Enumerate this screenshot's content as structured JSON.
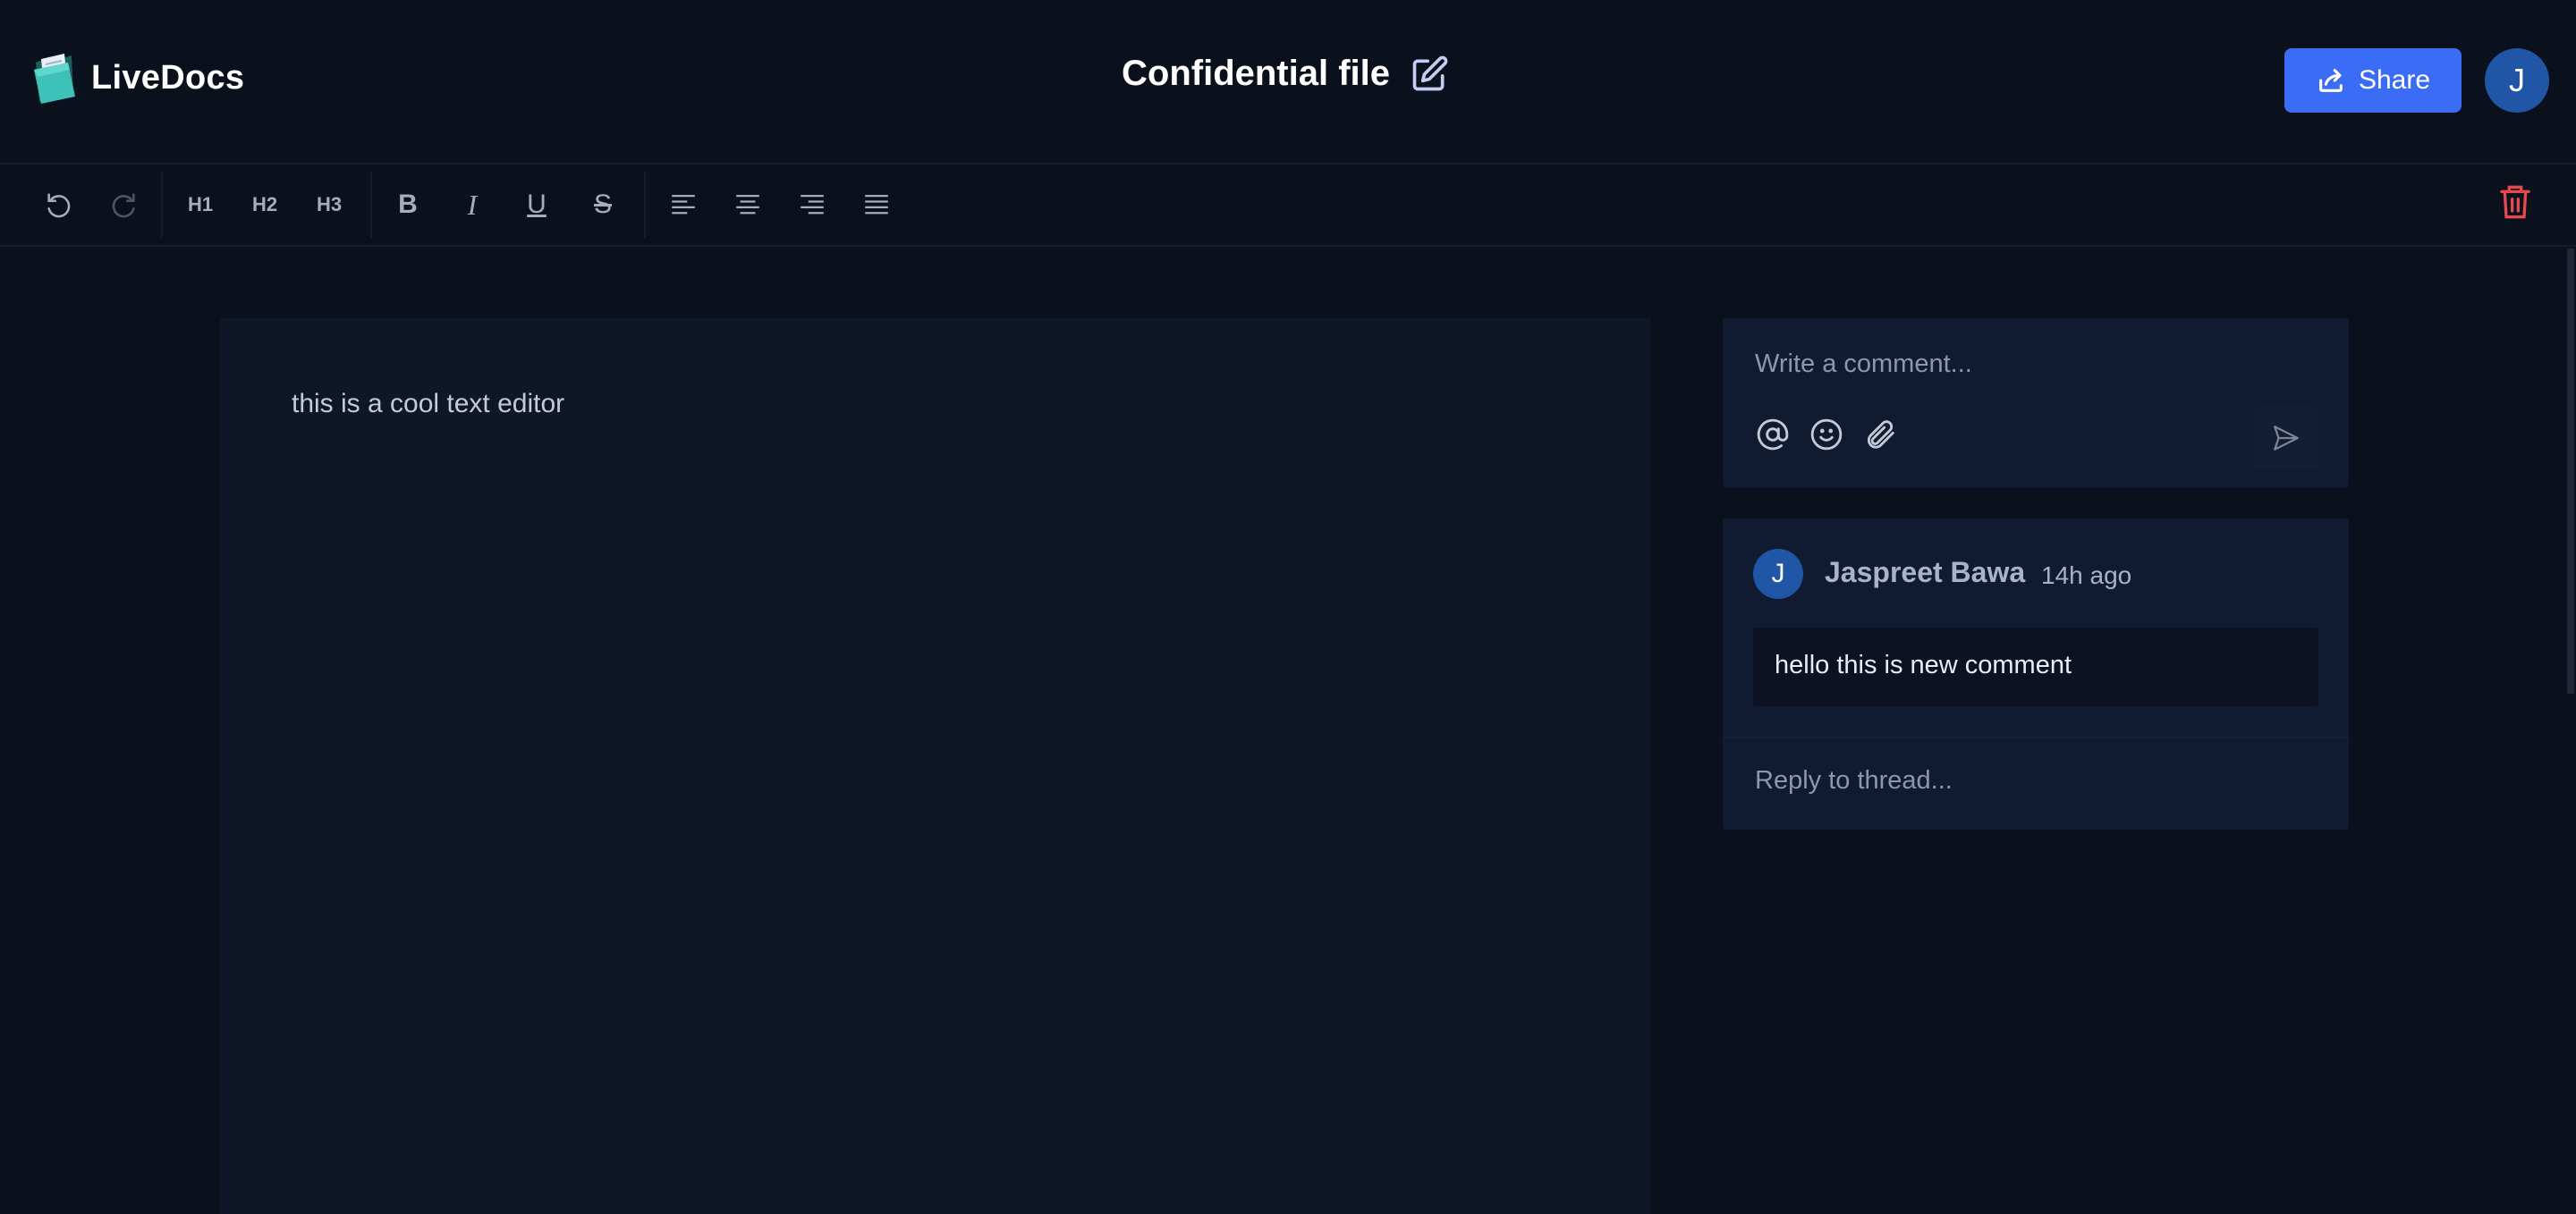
{
  "app": {
    "name": "LiveDocs"
  },
  "document": {
    "title": "Confidential file",
    "content": "this is a cool text editor"
  },
  "header": {
    "share_label": "Share",
    "avatar_initial": "J"
  },
  "toolbar": {
    "h1": "H1",
    "h2": "H2",
    "h3": "H3",
    "bold": "B",
    "italic": "I",
    "underline": "U",
    "strike": "S"
  },
  "composer": {
    "placeholder": "Write a comment..."
  },
  "thread": {
    "author": "Jaspreet Bawa",
    "author_initial": "J",
    "time": "14h ago",
    "comment": "hello this is new comment",
    "reply_placeholder": "Reply to thread..."
  },
  "icons": {
    "logo": "folder-doc-icon",
    "edit": "edit-icon",
    "share": "share-icon",
    "undo": "undo-icon",
    "redo": "redo-icon",
    "trash": "trash-icon",
    "align_left": "align-left-icon",
    "align_center": "align-center-icon",
    "align_right": "align-right-icon",
    "align_justify": "align-justify-icon",
    "mention": "at-icon",
    "emoji": "smile-icon",
    "attach": "paperclip-icon",
    "send": "send-icon"
  },
  "colors": {
    "background": "#0b101d",
    "editor_bg": "#0f1628",
    "panel_bg": "#101a30",
    "accent": "#3b6cf6",
    "avatar": "#2155a6",
    "danger": "#e5484d"
  }
}
